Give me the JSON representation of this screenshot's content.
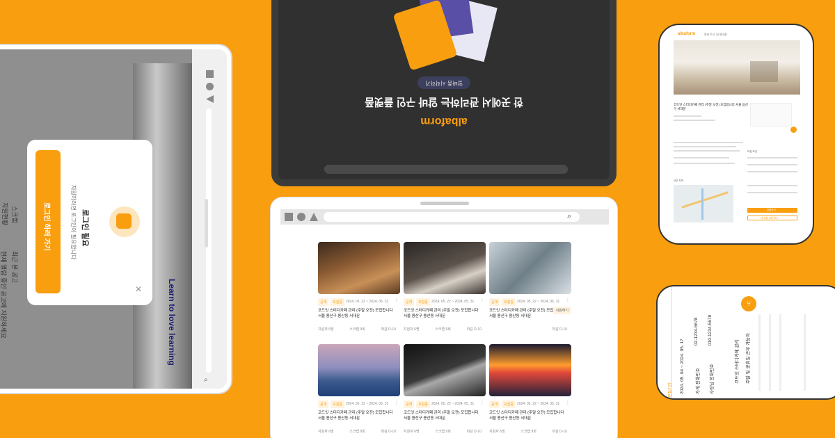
{
  "colors": {
    "background": "#F99E0E",
    "accent": "#F99E0E",
    "dark_screen": "#303030"
  },
  "left_tablet": {
    "modal": {
      "title": "로그인 필요",
      "subtitle": "지원하려면 로그인이 필요합니다",
      "button_label": "로그인 하러 가기",
      "close_icon": "close-icon"
    },
    "photo_text": "Learn to love learning",
    "sidebar": {
      "item1": "스크랩",
      "item2": "지원현황",
      "item3": "최근 본 공고",
      "item4": "현재 열람 중인 공고에 지원하세요"
    }
  },
  "dark_tablet": {
    "logo": "albaform",
    "headline": "한 곳에서 관리하는 알바 구인 플랫폼",
    "pill": "알바폼 시작하기",
    "illustration_logo": "albaform"
  },
  "grid_tablet": {
    "cards": [
      {
        "tags": [
          "공개",
          "모집중"
        ],
        "date": "2024. 05. 22 ~ 2024. 05. 31",
        "title": "코드잇 스터디카페 관리 (주말 오전) 모집합니다 서울 용산구 용산동 서대문",
        "applicants": "지원자 6명",
        "scrap": "스크랩 9회",
        "deadline": "마감 D-10",
        "img": "pastry"
      },
      {
        "tags": [
          "공개",
          "모집중"
        ],
        "date": "2024. 05. 22 ~ 2024. 05. 31",
        "title": "코드잇 스터디카페 관리 (주말 오전) 모집합니다 서울 용산구 용산동 서대문",
        "applicants": "지원자 6명",
        "scrap": "스크랩 9회",
        "deadline": "마감 D-10",
        "img": "coffee"
      },
      {
        "tags": [
          "공개",
          "모집중"
        ],
        "date": "2024. 05. 22 ~ 2024. 05. 31",
        "title": "코드잇 스터디카페 관리 (주말 오전) 모집합니다 서울 용산구 용산동 서대문",
        "applicants": "",
        "scrap": "",
        "deadline": "마감 D-10",
        "img": "window",
        "badge": "지원하기"
      },
      {
        "tags": [
          "공개",
          "모집중"
        ],
        "date": "2024. 05. 22 ~ 2024. 05. 31",
        "title": "코드잇 스터디카페 관리 (주말 오전) 모집합니다 서울 용산구 용산동 서대문",
        "applicants": "지원자 6명",
        "scrap": "스크랩 9회",
        "deadline": "마감 D-10",
        "img": "fuji"
      },
      {
        "tags": [
          "공개",
          "모집중"
        ],
        "date": "2024. 05. 22 ~ 2024. 05. 31",
        "title": "코드잇 스터디카페 관리 (주말 오전) 모집합니다 서울 용산구 용산동 서대문",
        "applicants": "지원자 6명",
        "scrap": "스크랩 9회",
        "deadline": "마감 D-10",
        "img": "film"
      },
      {
        "tags": [
          "공개",
          "모집중"
        ],
        "date": "2024. 05. 22 ~ 2024. 05. 31",
        "title": "코드잇 스터디카페 관리 (주말 오전) 모집합니다 서울 용산구 용산동 서대문",
        "applicants": "지원자 6명",
        "scrap": "스크랩 9회",
        "deadline": "마감 D-10",
        "img": "gas"
      }
    ]
  },
  "phone_top_right": {
    "brand": "albaform",
    "nav": "알바 토크  내 알바폼",
    "title": "코드잇 스터디카페 관리 (주말 오전) 모집합니다 서울 용산구 서대문",
    "section_map": "근무 지역",
    "section_cond": "모집 조건",
    "apply": "지원하기",
    "apply2": "내 지원 내역 보기"
  },
  "phone_bottom_right": {
    "tag": "모집기간",
    "period": "2024. 05. 04 ~ 2024. 05. 17",
    "phone1": "010-1234-5678",
    "phone2": "02-1234-5678",
    "text1": "코드잇 스터디카페 관리",
    "text2": "주말 및 공휴일 근무 가능자",
    "owner": "가게 전화번호",
    "owner2": "사장님 전화번호"
  }
}
